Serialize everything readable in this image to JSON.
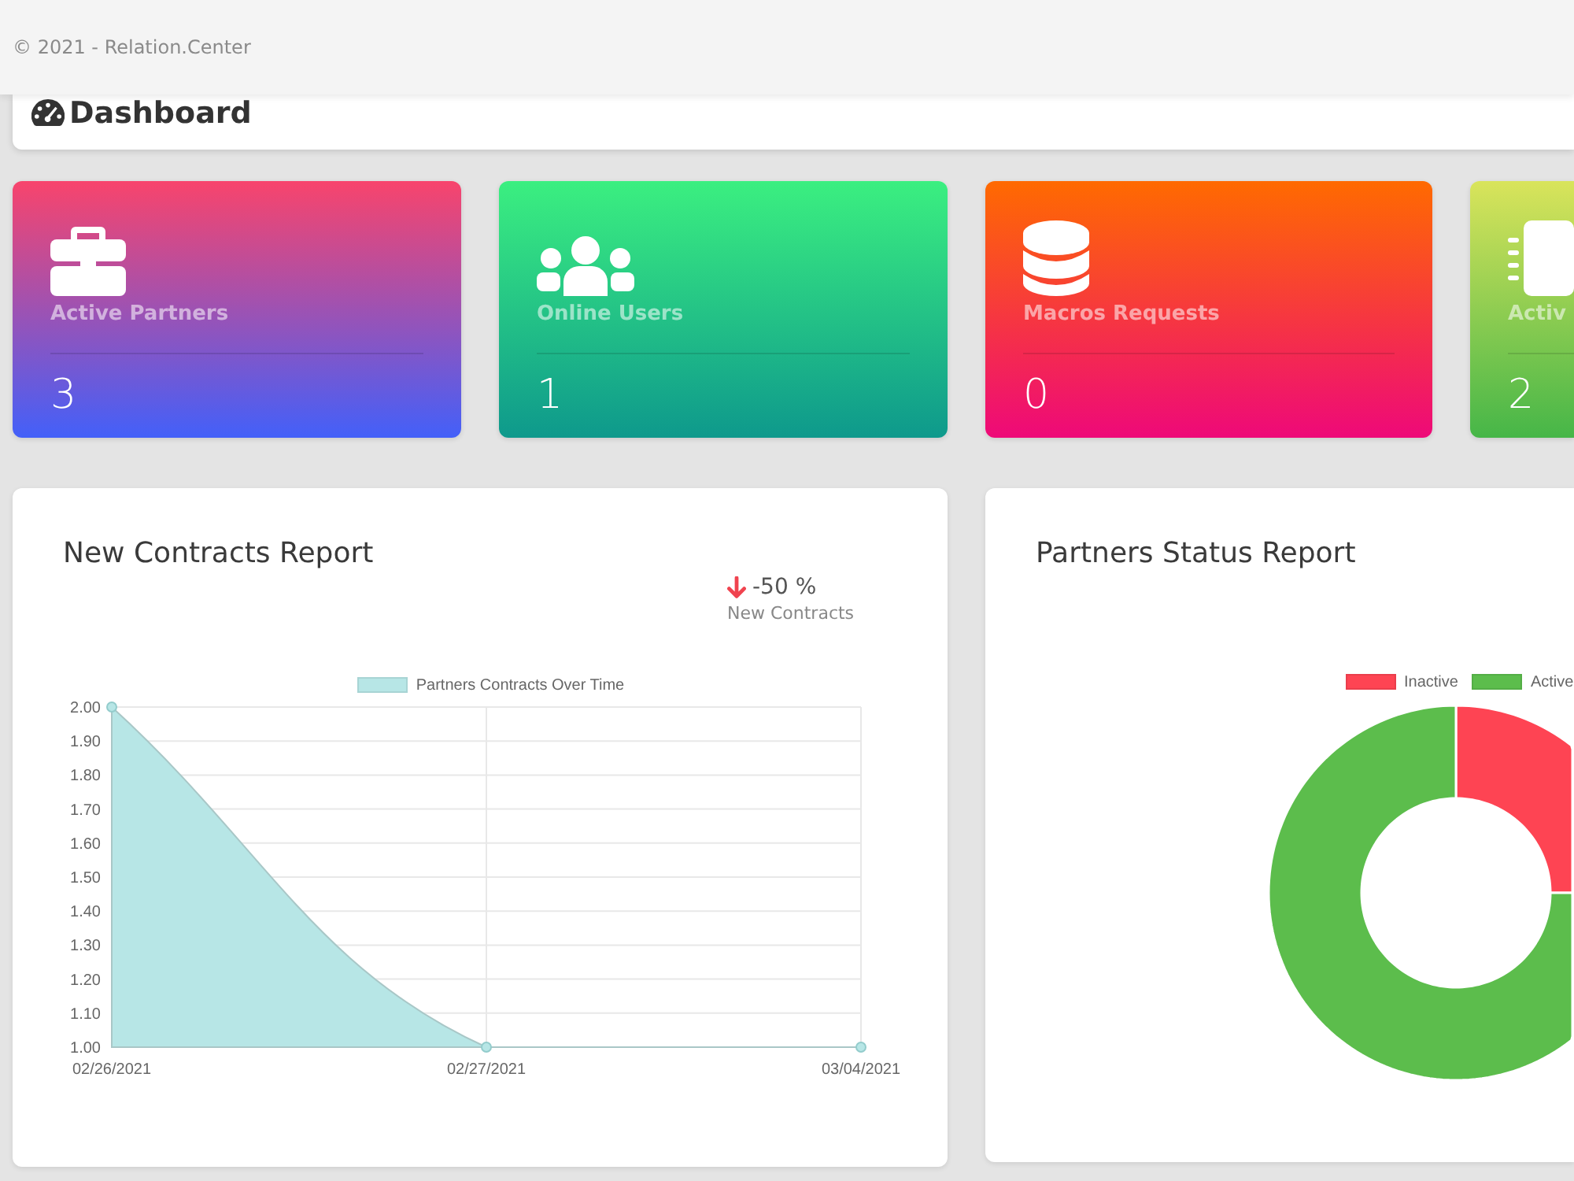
{
  "top_bar": {
    "copyright": "© 2021 - Relation.Center"
  },
  "page_header": {
    "title": "Dashboard"
  },
  "stat_cards": [
    {
      "label": "Active Partners",
      "value": "3"
    },
    {
      "label": "Online Users",
      "value": "1"
    },
    {
      "label": "Macros Requests",
      "value": "0"
    },
    {
      "label": "Activ",
      "value": "2"
    }
  ],
  "contracts_report": {
    "title": "New Contracts Report",
    "change": {
      "decreased": true,
      "value": "-50 %",
      "label": "New Contracts"
    },
    "chart_data": {
      "type": "area",
      "legend": "top",
      "grid": true,
      "categories": [
        "02/26/2021",
        "02/27/2021",
        "03/04/2021"
      ],
      "series": [
        {
          "name": "Partners Contracts Over Time",
          "color": "#b7e6e6",
          "values": [
            2,
            1,
            1
          ]
        }
      ],
      "ylim": [
        1,
        2
      ],
      "yticks": [
        {
          "value": 1,
          "label": "1.00"
        },
        {
          "value": 1.1,
          "label": "1.10"
        },
        {
          "value": 1.2,
          "label": "1.20"
        },
        {
          "value": 1.3,
          "label": "1.30"
        },
        {
          "value": 1.4,
          "label": "1.40"
        },
        {
          "value": 1.5,
          "label": "1.50"
        },
        {
          "value": 1.6,
          "label": "1.60"
        },
        {
          "value": 1.7,
          "label": "1.70"
        },
        {
          "value": 1.8,
          "label": "1.80"
        },
        {
          "value": 1.9,
          "label": "1.90"
        },
        {
          "value": 2,
          "label": "2.00"
        }
      ]
    }
  },
  "partners_status_report": {
    "title": "Partners Status Report",
    "chart_data": {
      "type": "donut",
      "legend": "top",
      "categories": [
        "Inactive",
        "Active"
      ],
      "values": [
        25,
        75
      ],
      "colors": [
        "#fe4453",
        "#5cbd4c"
      ]
    }
  }
}
